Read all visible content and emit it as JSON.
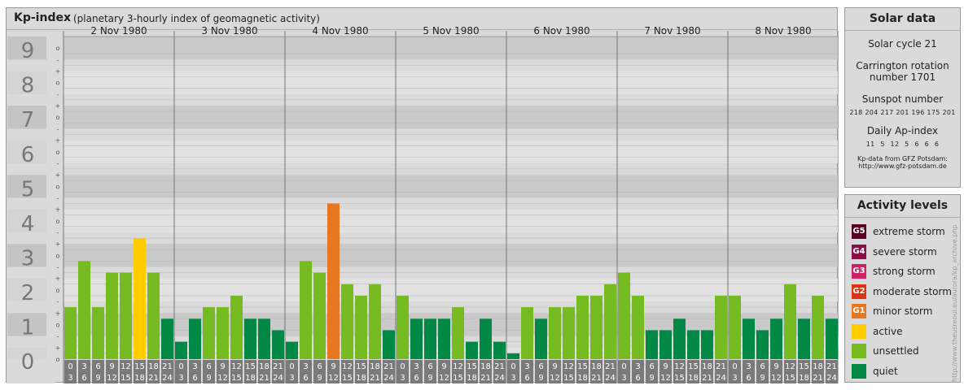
{
  "title": {
    "main": "Kp-index",
    "sub": "(planetary 3-hourly index of geomagnetic activity)"
  },
  "chart_data": {
    "type": "bar",
    "ylim": [
      0,
      9
    ],
    "y_ticks": [
      "0",
      "1",
      "2",
      "3",
      "4",
      "5",
      "6",
      "7",
      "8",
      "9"
    ],
    "minor_tick_labels": [
      "o",
      "-",
      "+"
    ],
    "days": [
      "2 Nov 1980",
      "3 Nov 1980",
      "4 Nov 1980",
      "5 Nov 1980",
      "6 Nov 1980",
      "7 Nov 1980",
      "8 Nov 1980"
    ],
    "hour_start_labels": [
      "0",
      "3",
      "6",
      "9",
      "12",
      "15",
      "18",
      "21"
    ],
    "hour_end_labels": [
      "3",
      "6",
      "9",
      "12",
      "15",
      "18",
      "21",
      "24"
    ],
    "values": [
      [
        1.667,
        3.0,
        1.667,
        2.667,
        2.667,
        3.667,
        2.667,
        1.333
      ],
      [
        0.667,
        1.333,
        1.667,
        1.667,
        2.0,
        1.333,
        1.333,
        1.0
      ],
      [
        0.667,
        3.0,
        2.667,
        4.667,
        2.333,
        2.0,
        2.333,
        1.0
      ],
      [
        2.0,
        1.333,
        1.333,
        1.333,
        1.667,
        0.667,
        1.333,
        0.667
      ],
      [
        0.333,
        1.667,
        1.333,
        1.667,
        1.667,
        2.0,
        2.0,
        2.333
      ],
      [
        2.667,
        2.0,
        1.0,
        1.0,
        1.333,
        1.0,
        1.0,
        2.0
      ],
      [
        2.0,
        1.333,
        1.0,
        1.333,
        2.333,
        1.333,
        2.0,
        1.333
      ]
    ],
    "colors": {
      "quiet": "#008844",
      "unsettled": "#77bb22",
      "active": "#ffcc00",
      "minor": "#e87722",
      "grid_light": "#e1e1e1",
      "grid_dark": "#c9c9c9",
      "axis_label_bg": "#7a7a7a",
      "axis_label_fg": "#ffffff"
    }
  },
  "solar": {
    "title": "Solar data",
    "cycle": "Solar cycle 21",
    "carrington_1": "Carrington rotation",
    "carrington_2": "number 1701",
    "sunspot_title": "Sunspot number",
    "sunspot_values": "218 204 217 201 196 175 201",
    "ap_title": "Daily Ap-index",
    "ap_values": "11  5  12  5  6  6  6",
    "credit_1": "Kp-data from GFZ Potsdam:",
    "credit_2": "http://www.gfz-potsdam.de"
  },
  "activity": {
    "title": "Activity levels",
    "items": [
      {
        "code": "G5",
        "label": "extreme storm",
        "color": "#5a0022"
      },
      {
        "code": "G4",
        "label": "severe storm",
        "color": "#88114a"
      },
      {
        "code": "G3",
        "label": "strong storm",
        "color": "#cc2266"
      },
      {
        "code": "G2",
        "label": "moderate storm",
        "color": "#dd3311"
      },
      {
        "code": "G1",
        "label": "minor storm",
        "color": "#e87722"
      },
      {
        "code": "",
        "label": "active",
        "color": "#ffcc00"
      },
      {
        "code": "",
        "label": "unsettled",
        "color": "#77bb22"
      },
      {
        "code": "",
        "label": "quiet",
        "color": "#008844"
      }
    ]
  },
  "watermark": "http://www.theusreoui.eu/aurora/kp_archive.php"
}
